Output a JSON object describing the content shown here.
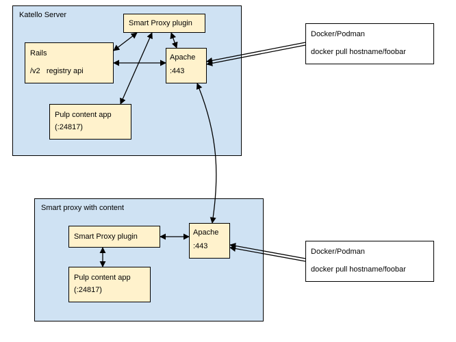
{
  "katello": {
    "title": "Katello Server",
    "smart_proxy_plugin": "Smart Proxy plugin",
    "rails_line1": "Rails",
    "rails_line2": "/v2   registry api",
    "apache_line1": "Apache",
    "apache_line2": ":443",
    "pulp_line1": "Pulp content app",
    "pulp_line2": "(:24817)"
  },
  "proxy": {
    "title": "Smart proxy with content",
    "smart_proxy_plugin": "Smart Proxy plugin",
    "apache_line1": "Apache",
    "apache_line2": ":443",
    "pulp_line1": "Pulp content app",
    "pulp_line2": "(:24817)"
  },
  "client1": {
    "title": "Docker/Podman",
    "cmd": "docker pull hostname/foobar"
  },
  "client2": {
    "title": "Docker/Podman",
    "cmd": "docker pull hostname/foobar"
  }
}
